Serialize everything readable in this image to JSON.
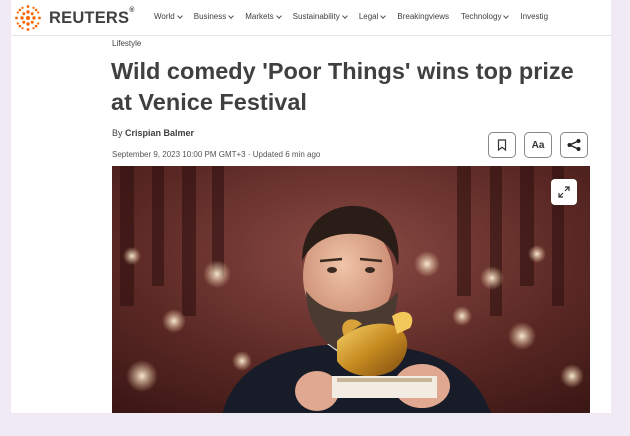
{
  "brand": {
    "name": "REUTERS",
    "registered": "®"
  },
  "nav": {
    "items": [
      {
        "label": "World",
        "has_menu": true
      },
      {
        "label": "Business",
        "has_menu": true
      },
      {
        "label": "Markets",
        "has_menu": true
      },
      {
        "label": "Sustainability",
        "has_menu": true
      },
      {
        "label": "Legal",
        "has_menu": true
      },
      {
        "label": "Breakingviews",
        "has_menu": false
      },
      {
        "label": "Technology",
        "has_menu": true
      },
      {
        "label": "Investig",
        "has_menu": false
      }
    ]
  },
  "article": {
    "section": "Lifestyle",
    "headline": "Wild comedy 'Poor Things' wins top prize at Venice Festival",
    "byline_prefix": "By",
    "author": "Crispian Balmer",
    "date": "September 9, 2023 10:00 PM GMT+3 · Updated 6 min ago"
  },
  "tools": {
    "font_label": "Aa",
    "bookmark_icon": "bookmark-icon",
    "share_icon": "share-icon"
  },
  "photo": {
    "expand_icon": "expand-icon"
  },
  "colors": {
    "text": "#404040",
    "brand_orange": "#fa6400",
    "page_bg": "#efeaf3"
  }
}
